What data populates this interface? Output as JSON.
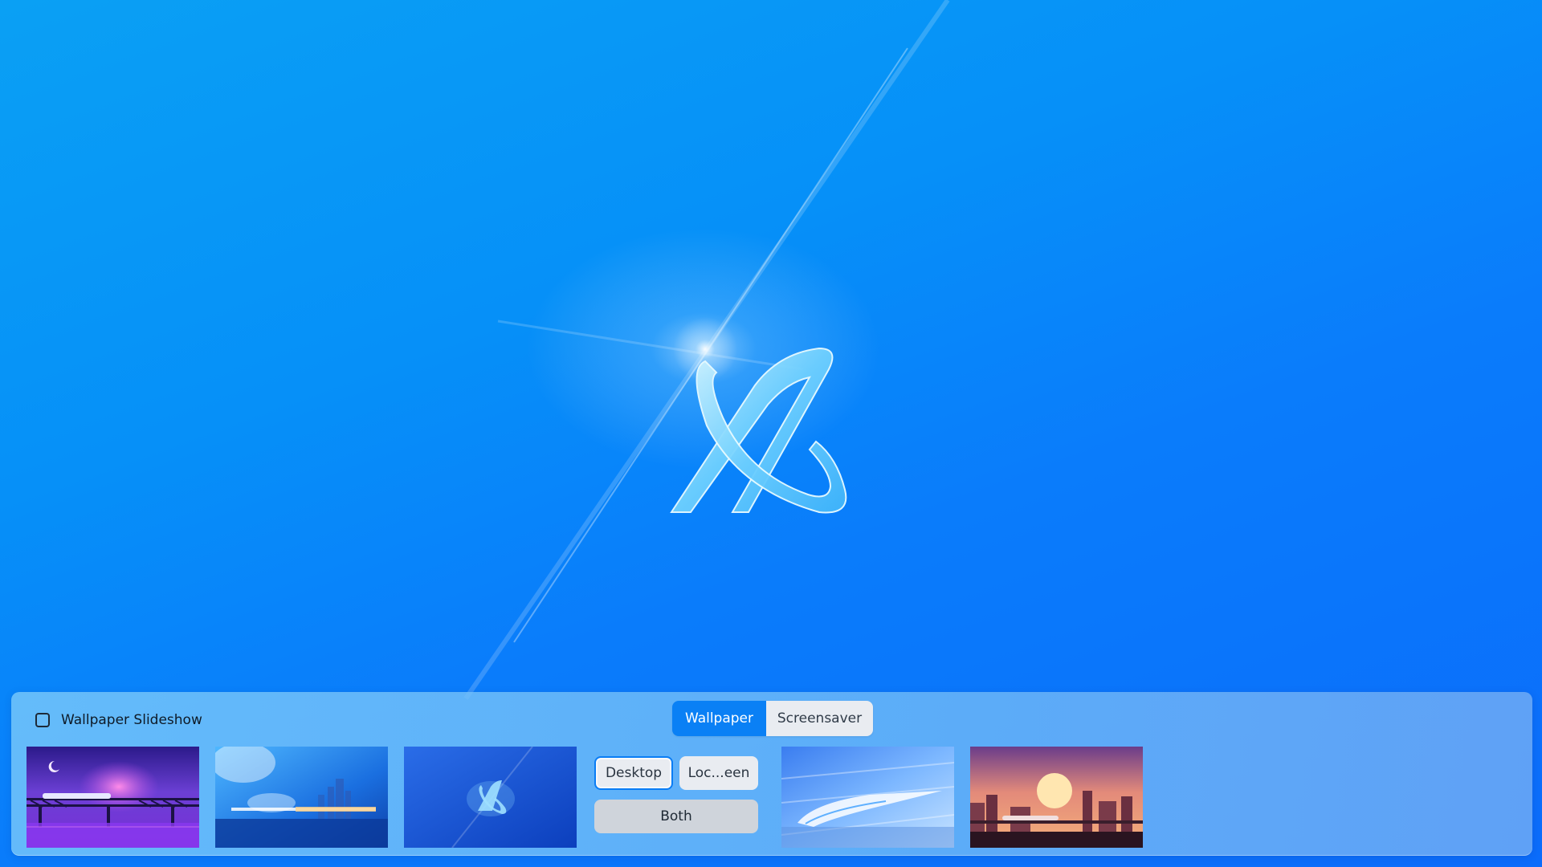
{
  "desktop": {
    "background_colors": [
      "#0aa0f4",
      "#0a7cfb",
      "#0b6cfb"
    ],
    "logo_icon": "kylin-logo-icon"
  },
  "panel": {
    "slideshow": {
      "label": "Wallpaper Slideshow",
      "checked": false
    },
    "tabs": [
      {
        "label": "Wallpaper",
        "active": true
      },
      {
        "label": "Screensaver",
        "active": false
      }
    ],
    "thumbnails": [
      {
        "name": "night-train-bridge"
      },
      {
        "name": "blue-city-train"
      },
      {
        "name": "blue-logo"
      },
      {
        "name": "speed-train"
      },
      {
        "name": "sunset-city-train"
      }
    ],
    "apply_options": {
      "desktop": "Desktop",
      "lock_screen": "Loc...een",
      "both": "Both"
    },
    "accent_color": "#0a80f5"
  }
}
